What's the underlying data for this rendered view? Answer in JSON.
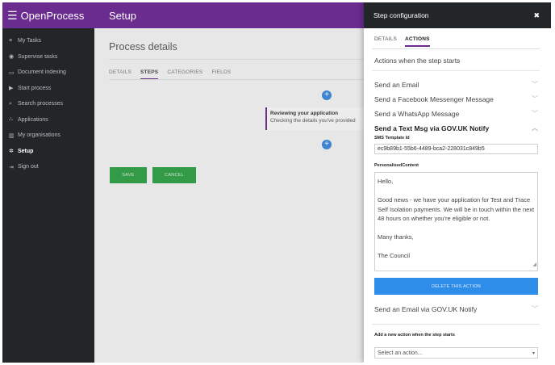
{
  "app": {
    "name": "OpenProcess",
    "menu_icon": "hamburger-icon"
  },
  "sidebar": {
    "items": [
      {
        "label": "My Tasks",
        "icon": "list-icon",
        "active": false
      },
      {
        "label": "Supervise tasks",
        "icon": "eye-icon",
        "active": false
      },
      {
        "label": "Document indexing",
        "icon": "inbox-icon",
        "active": false
      },
      {
        "label": "Start process",
        "icon": "play-icon",
        "active": false
      },
      {
        "label": "Search processes",
        "icon": "search-icon",
        "active": false
      },
      {
        "label": "Applications",
        "icon": "sitemap-icon",
        "active": false
      },
      {
        "label": "My organisations",
        "icon": "building-icon",
        "active": false
      },
      {
        "label": "Setup",
        "icon": "gear-icon",
        "active": true
      },
      {
        "label": "Sign out",
        "icon": "sign-out-icon",
        "active": false
      }
    ]
  },
  "header": {
    "title": "Setup"
  },
  "main": {
    "title": "Process details",
    "tabs": [
      {
        "label": "DETAILS",
        "active": false
      },
      {
        "label": "STEPS",
        "active": true
      },
      {
        "label": "CATEGORIES",
        "active": false
      },
      {
        "label": "FIELDS",
        "active": false
      }
    ],
    "add_icon": "+",
    "step": {
      "title": "Reviewing your application",
      "description": "Checking the details you've provided"
    },
    "save_label": "SAVE",
    "cancel_label": "CANCEL"
  },
  "drawer": {
    "title": "Step configuration",
    "close_label": "✖",
    "tabs": [
      {
        "label": "DETAILS",
        "active": false
      },
      {
        "label": "ACTIONS",
        "active": true
      }
    ],
    "section_title": "Actions when the step starts",
    "actions": [
      {
        "label": "Send an Email",
        "expanded": false
      },
      {
        "label": "Send a Facebook Messenger Message",
        "expanded": false
      },
      {
        "label": "Send a WhatsApp Message",
        "expanded": false
      },
      {
        "label": "Send a Text Msg via GOV.UK Notify",
        "expanded": true
      }
    ],
    "sms_template_label": "SMS Template Id",
    "sms_template_value": "ec9b89b1-55b6-4489-bca2-228031c849b5",
    "personalised_label": "PersonalisedContent",
    "personalised_value": "Hello,\n\nGood news - we have your application for Test and Trace Self Isolation payments. We will be in touch within the next 48 hours on whether you're eligible or not.\n\nMany thanks,\n\nThe Council",
    "delete_label": "DELETE THIS ACTION",
    "after_action": "Send an Email via GOV.UK Notify",
    "add_action_label": "Add a new action when the step starts",
    "select_placeholder": "Select an action..."
  },
  "colors": {
    "brand_purple": "#6a2c8e",
    "sidebar_dark": "#222629",
    "accent_blue": "#2e8de8",
    "success_green": "#2e9e44"
  }
}
